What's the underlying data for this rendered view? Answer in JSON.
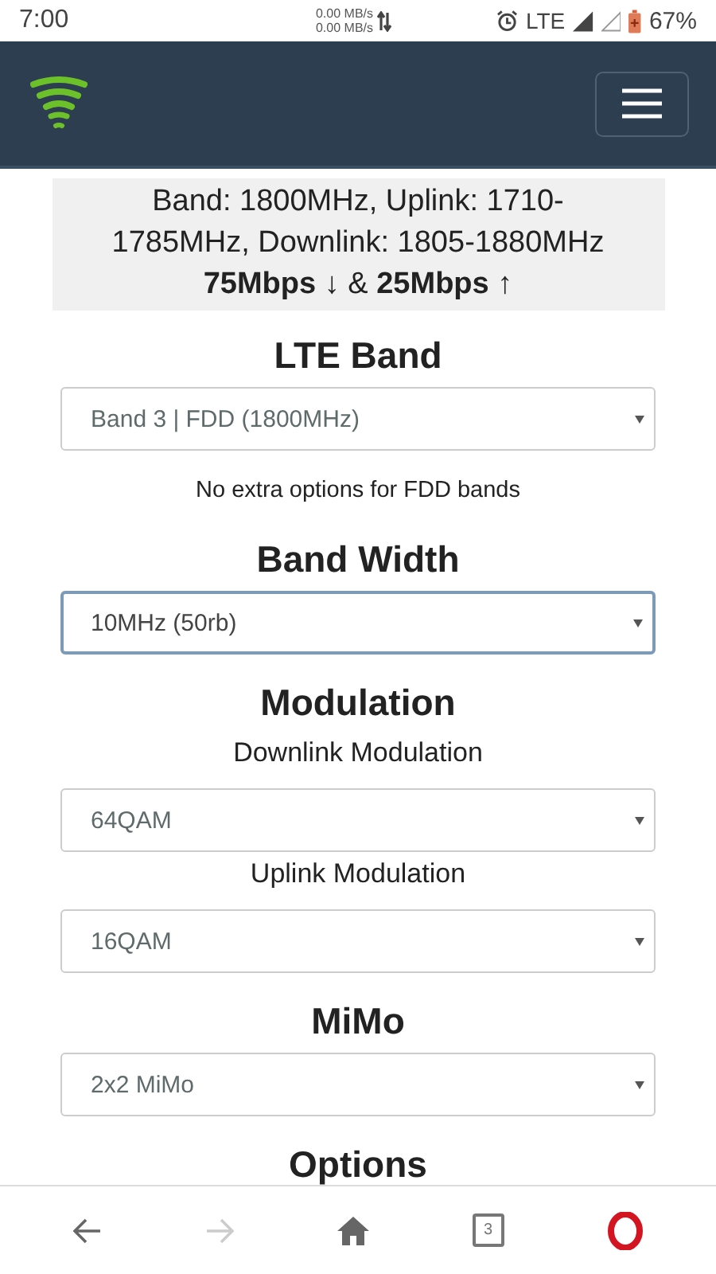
{
  "status_bar": {
    "time": "7:00",
    "upload_speed": "0.00 MB/s",
    "download_speed": "0.00 MB/s",
    "network": "LTE",
    "battery": "67%"
  },
  "navbar": {
    "menu_expanded": false
  },
  "info": {
    "text": "Band: 1800MHz, Uplink: 1710-1785MHz, Downlink: 1805-1880MHz",
    "speeds": "**75Mbps** ↓ & **25Mbps** ↑"
  },
  "form": [
    {
      "kind": "heading",
      "text": "LTE Band"
    },
    {
      "kind": "select",
      "value": "Band 3 | FDD (1800MHz)",
      "focused": false
    },
    {
      "kind": "note",
      "text": "No extra options for FDD bands"
    },
    {
      "kind": "heading",
      "text": "Band Width"
    },
    {
      "kind": "select",
      "value": "10MHz (50rb)",
      "focused": true
    },
    {
      "kind": "heading",
      "text": "Modulation"
    },
    {
      "kind": "label",
      "text": "Downlink Modulation"
    },
    {
      "kind": "select",
      "value": "64QAM",
      "focused": false
    },
    {
      "kind": "label",
      "text": "Uplink Modulation"
    },
    {
      "kind": "select",
      "value": "16QAM",
      "focused": false
    },
    {
      "kind": "heading",
      "text": "MiMo"
    },
    {
      "kind": "select",
      "value": "2x2 MiMo",
      "focused": false
    },
    {
      "kind": "heading",
      "text": "Options"
    }
  ],
  "bottom_bar": {
    "back_disabled": false,
    "forward_disabled": true,
    "tab_count": "3"
  }
}
